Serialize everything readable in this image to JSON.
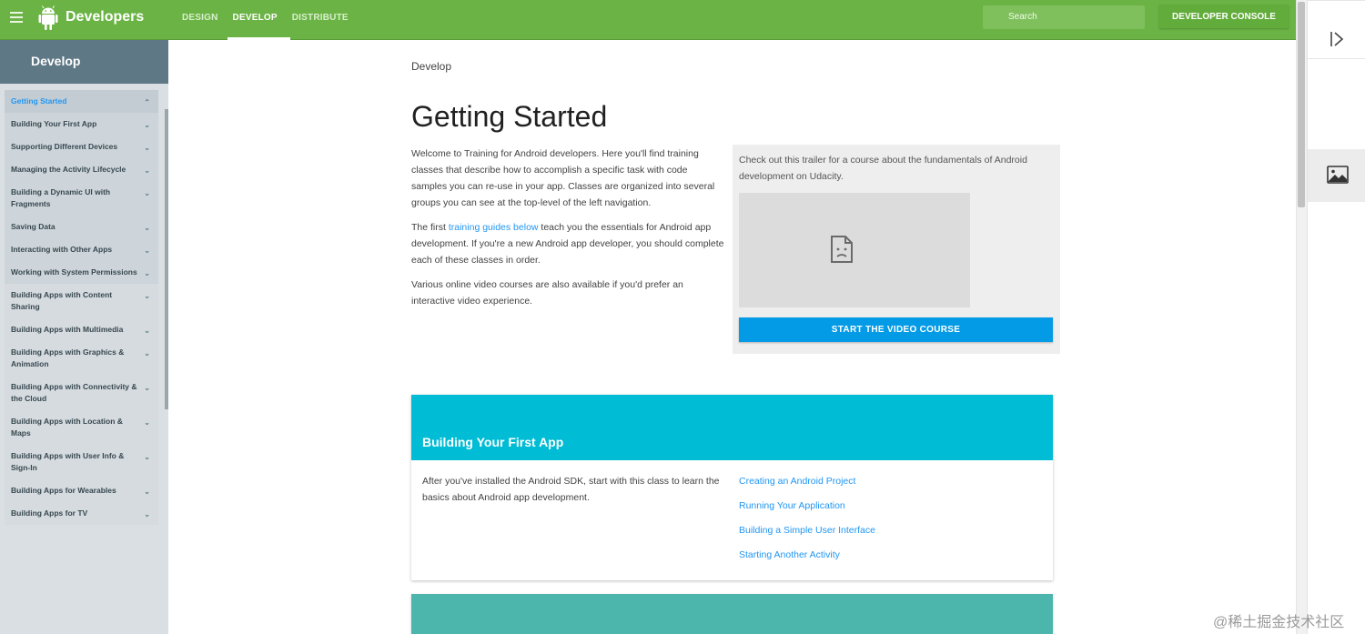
{
  "topbar": {
    "brand": "Developers",
    "tabs": [
      {
        "label": "DESIGN",
        "active": false
      },
      {
        "label": "DEVELOP",
        "active": true
      },
      {
        "label": "DISTRIBUTE",
        "active": false
      }
    ],
    "search_placeholder": "Search",
    "console_label": "DEVELOPER CONSOLE",
    "brand_color": "#6ab344"
  },
  "sidebar": {
    "heading": "Develop",
    "items": [
      {
        "label": "Getting Started",
        "state": "active"
      },
      {
        "label": "Building Your First App",
        "state": "grouped"
      },
      {
        "label": "Supporting Different Devices",
        "state": "grouped"
      },
      {
        "label": "Managing the Activity Lifecycle",
        "state": "grouped"
      },
      {
        "label": "Building a Dynamic UI with Fragments",
        "state": "grouped"
      },
      {
        "label": "Saving Data",
        "state": "grouped"
      },
      {
        "label": "Interacting with Other Apps",
        "state": "grouped"
      },
      {
        "label": "Working with System Permissions",
        "state": "grouped"
      },
      {
        "label": "Building Apps with Content Sharing",
        "state": "normal"
      },
      {
        "label": "Building Apps with Multimedia",
        "state": "normal"
      },
      {
        "label": "Building Apps with Graphics & Animation",
        "state": "normal"
      },
      {
        "label": "Building Apps with Connectivity & the Cloud",
        "state": "normal"
      },
      {
        "label": "Building Apps with Location & Maps",
        "state": "normal"
      },
      {
        "label": "Building Apps with User Info & Sign-In",
        "state": "normal"
      },
      {
        "label": "Building Apps for Wearables",
        "state": "normal"
      },
      {
        "label": "Building Apps for TV",
        "state": "normal"
      }
    ]
  },
  "main": {
    "breadcrumb": "Develop",
    "title": "Getting Started",
    "intro": {
      "p1": "Welcome to Training for Android developers. Here you'll find training classes that describe how to accomplish a specific task with code samples you can re-use in your app. Classes are organized into several groups you can see at the top-level of the left navigation.",
      "p2_before": "The first ",
      "p2_link": "training guides below",
      "p2_after": " teach you the essentials for Android app development. If you're a new Android app developer, you should complete each of these classes in order.",
      "p3": "Various online video courses are also available if you'd prefer an interactive video experience."
    },
    "video": {
      "text": "Check out this trailer for a course about the fundamentals of Android development on Udacity.",
      "button": "START THE VIDEO COURSE",
      "icon": "broken-file-icon"
    },
    "course": {
      "title": "Building Your First App",
      "description": "After you've installed the Android SDK, start with this class to learn the basics about Android app development.",
      "links": [
        "Creating an Android Project",
        "Running Your Application",
        "Building a Simple User Interface",
        "Starting Another Activity"
      ],
      "header_color": "#00bcd4"
    },
    "next_card_color": "#4db6ac"
  },
  "right_panel": {
    "icons": [
      "expand-panel-icon",
      "image-icon"
    ]
  },
  "watermark": "@稀土掘金技术社区"
}
